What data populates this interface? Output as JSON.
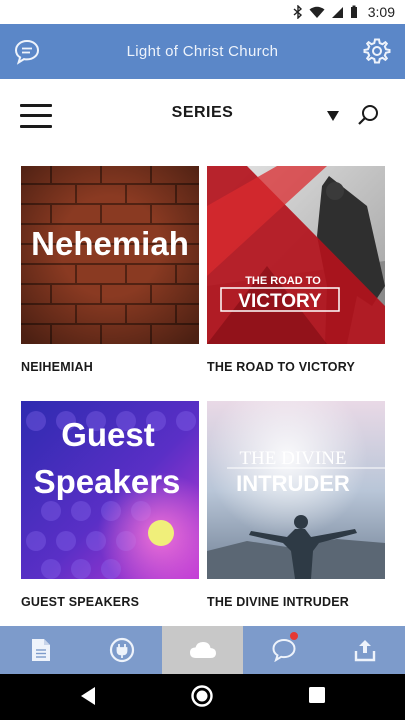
{
  "status_bar": {
    "time": "3:09"
  },
  "header": {
    "title": "Light of Christ Church"
  },
  "section": {
    "title": "SERIES"
  },
  "series": [
    {
      "label": "NEIHEMIAH",
      "art_text": "Nehemiah"
    },
    {
      "label": "THE ROAD TO VICTORY",
      "art_line1": "THE ROAD TO",
      "art_line2": "VICTORY"
    },
    {
      "label": "GUEST SPEAKERS",
      "art_line1": "Guest",
      "art_line2": "Speakers"
    },
    {
      "label": "THE DIVINE INTRUDER",
      "art_line1": "THE DIVINE",
      "art_line2": "INTRUDER"
    }
  ],
  "bottom_nav": {
    "tabs": [
      "document-icon",
      "plug-icon",
      "cloud-icon",
      "chat-bubble-icon",
      "share-upload-icon"
    ],
    "active_index": 2
  },
  "colors": {
    "appbar": "#5b87c8",
    "bottomnav": "#7d9bcb",
    "active_tab": "#c8c8c8",
    "badge": "#e53935"
  }
}
